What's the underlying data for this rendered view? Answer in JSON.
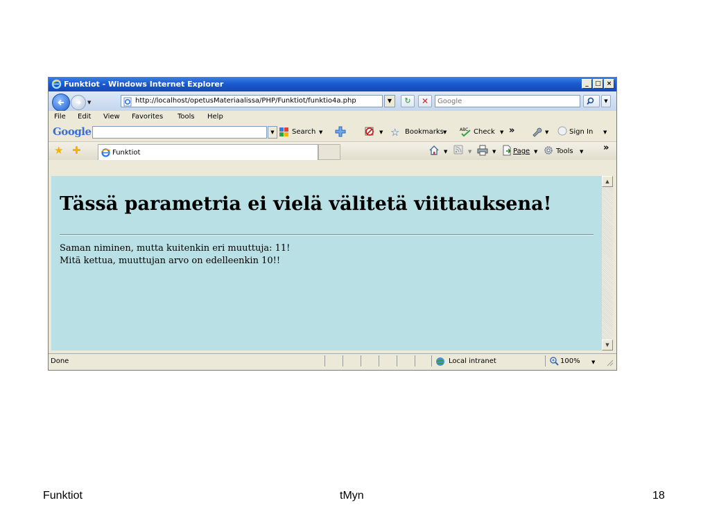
{
  "window": {
    "title": "Funktiot - Windows Internet Explorer",
    "controls": {
      "minimize": "_",
      "maximize": "□",
      "close": "×"
    }
  },
  "address_bar": {
    "url": "http://localhost/opetusMateriaalissa/PHP/Funktiot/funktio4a.php",
    "search_placeholder": "Google"
  },
  "menu": [
    {
      "label": "File",
      "key": "F"
    },
    {
      "label": "Edit",
      "key": "E"
    },
    {
      "label": "View",
      "key": "V"
    },
    {
      "label": "Favorites",
      "key": "a"
    },
    {
      "label": "Tools",
      "key": "T"
    },
    {
      "label": "Help",
      "key": "H"
    }
  ],
  "google_toolbar": {
    "logo": "Google",
    "search": "Search",
    "bookmarks": "Bookmarks",
    "check": "Check",
    "more": "»",
    "sign_in": "Sign In"
  },
  "favorites_bar": {
    "tab_label": "Funktiot",
    "page": "Page",
    "tools": "Tools",
    "more": "»"
  },
  "page": {
    "heading": "Tässä parametria ei vielä välitetä viittauksena!",
    "lines": [
      "Saman niminen, mutta kuitenkin eri muuttuja: 11!",
      "Mitä kettua, muuttujan arvo on edelleenkin 10!!"
    ]
  },
  "status_bar": {
    "status": "Done",
    "zone": "Local intranet",
    "zoom": "100%"
  },
  "slide_footer": {
    "left": "Funktiot",
    "center": "tMyn",
    "page_number": "18"
  },
  "colors": {
    "content_bg": "#b9e0e4",
    "titlebar": "#1a5ad0"
  }
}
